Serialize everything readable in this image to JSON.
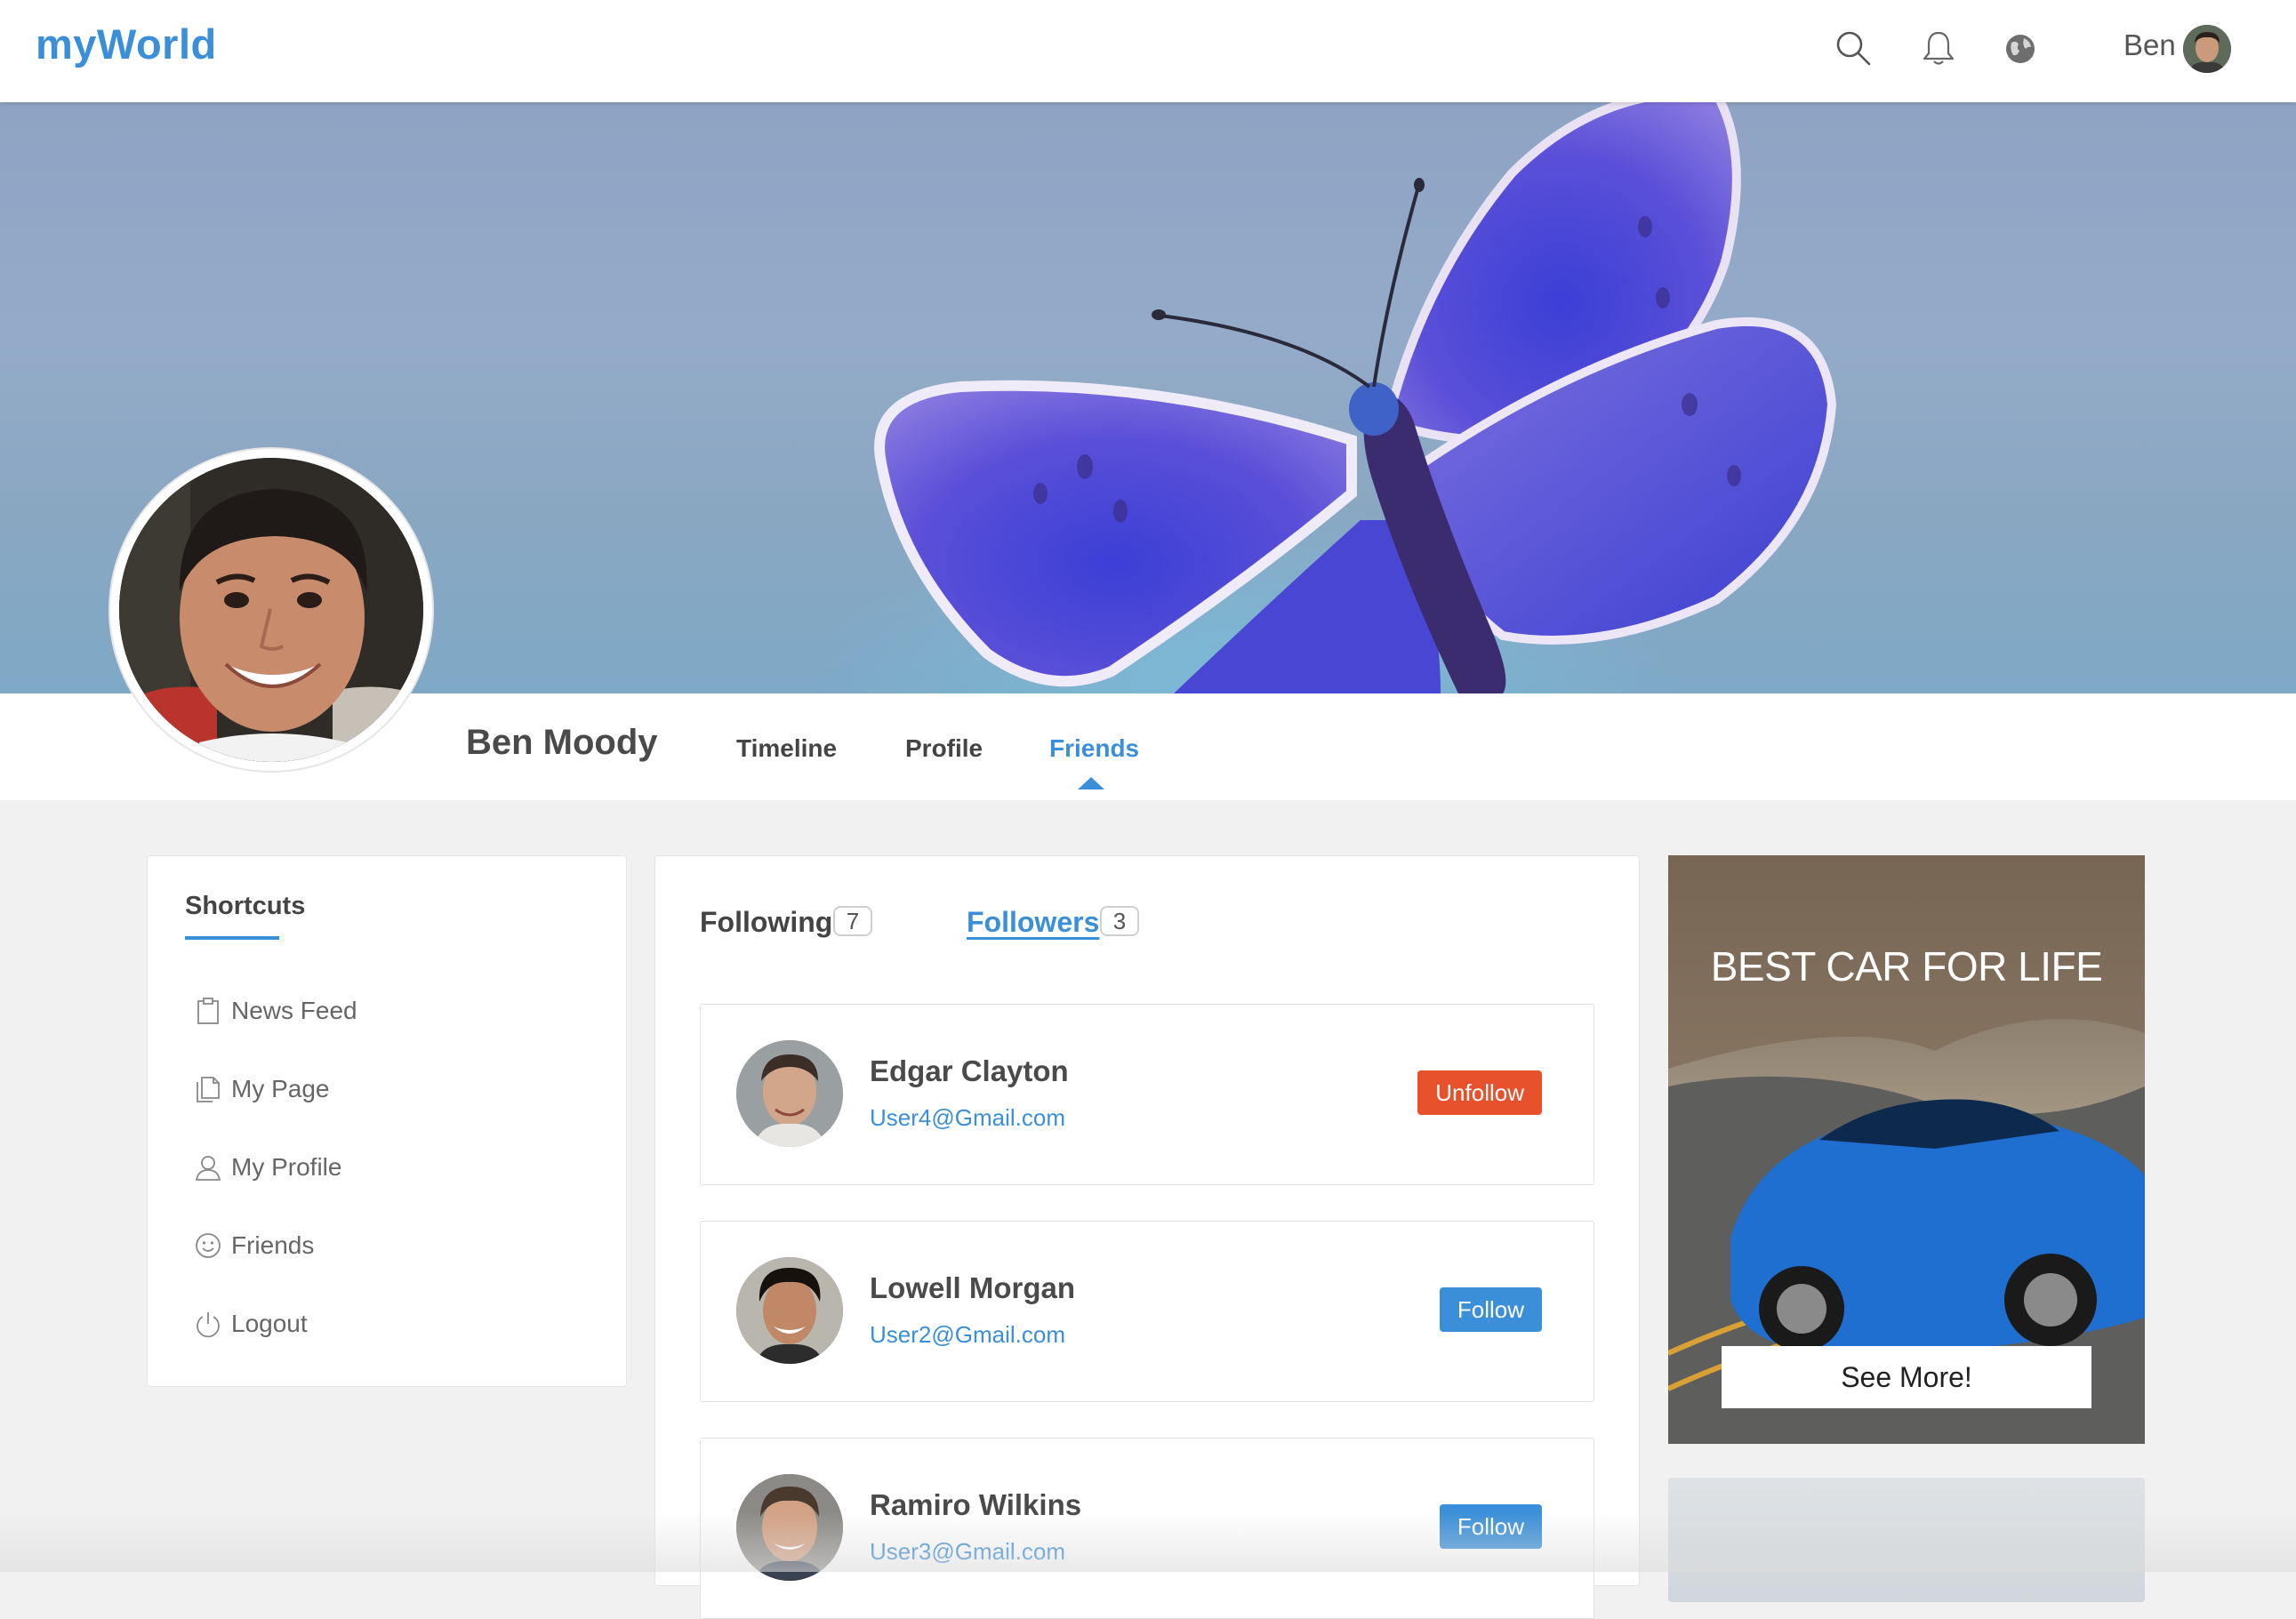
{
  "app": {
    "logo": "myWorld"
  },
  "topbar": {
    "icons": [
      "search-icon",
      "bell-icon",
      "globe-icon"
    ],
    "user_name": "Ben"
  },
  "profile": {
    "name": "Ben Moody",
    "tabs": [
      {
        "label": "Timeline",
        "active": false
      },
      {
        "label": "Profile",
        "active": false
      },
      {
        "label": "Friends",
        "active": true
      }
    ]
  },
  "shortcuts": {
    "title": "Shortcuts",
    "items": [
      {
        "label": "News Feed",
        "icon": "clipboard-icon"
      },
      {
        "label": "My Page",
        "icon": "pages-icon"
      },
      {
        "label": "My Profile",
        "icon": "user-icon"
      },
      {
        "label": "Friends",
        "icon": "smiley-icon"
      },
      {
        "label": "Logout",
        "icon": "power-icon"
      }
    ]
  },
  "friends": {
    "tabs": [
      {
        "label": "Following",
        "count": "7",
        "active": false
      },
      {
        "label": "Followers",
        "count": "3",
        "active": true
      }
    ],
    "list": [
      {
        "name": "Edgar Clayton",
        "email": "User4@Gmail.com",
        "action": "Unfollow"
      },
      {
        "name": "Lowell Morgan",
        "email": "User2@Gmail.com",
        "action": "Follow"
      },
      {
        "name": "Ramiro Wilkins",
        "email": "User3@Gmail.com",
        "action": "Follow"
      }
    ]
  },
  "ad": {
    "title": "BEST CAR FOR LIFE",
    "button": "See More!"
  },
  "colors": {
    "accent": "#3a8fd8",
    "unfollow": "#e7522c",
    "background": "#f2f1f1"
  }
}
